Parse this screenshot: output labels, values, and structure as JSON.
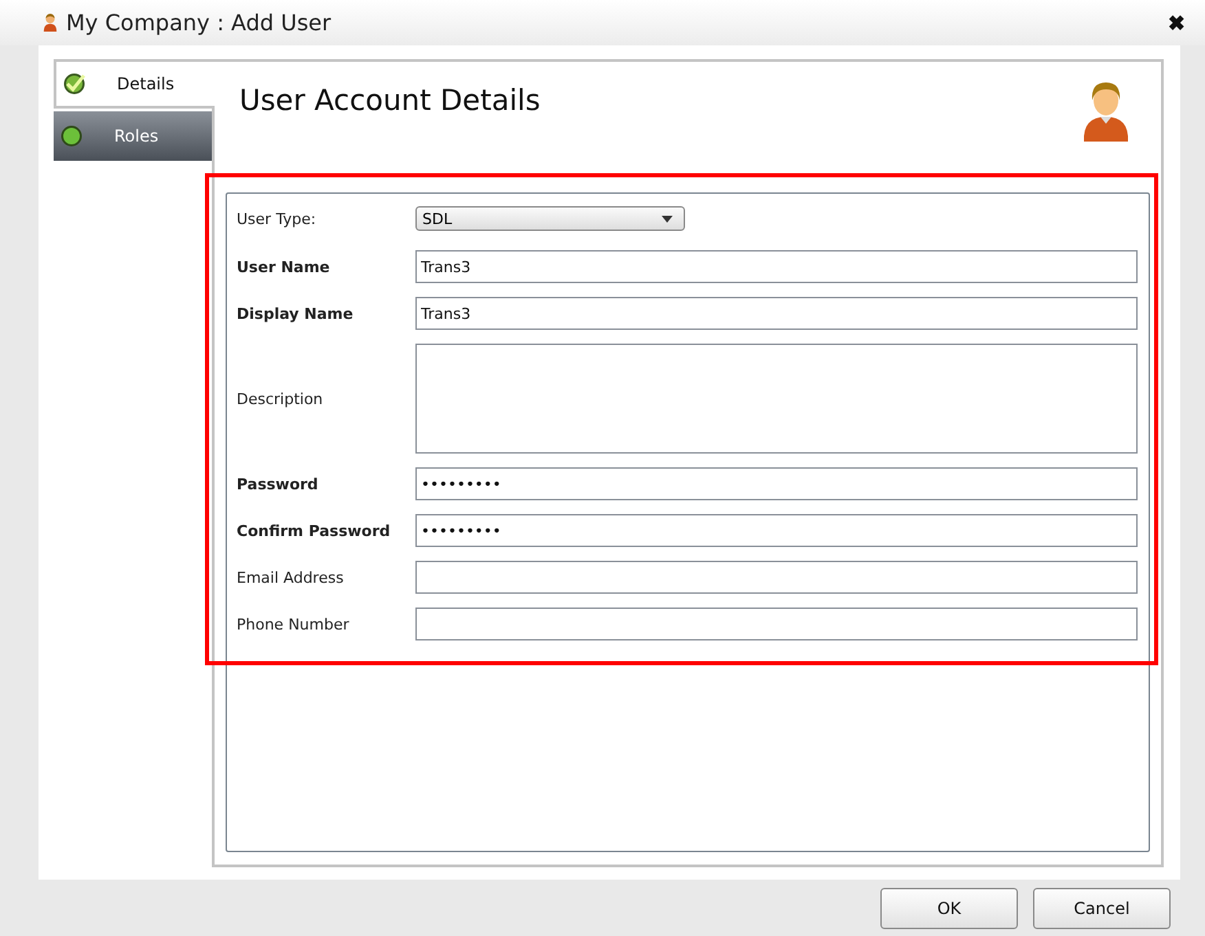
{
  "window": {
    "title": "My Company : Add User",
    "close": "✖"
  },
  "tabs": [
    {
      "label": "Details",
      "selected": true,
      "completed": true
    },
    {
      "label": "Roles",
      "selected": false,
      "completed": false
    }
  ],
  "heading": "User Account Details",
  "form": [
    {
      "kind": "dropdown",
      "label": "User Type:",
      "required": false,
      "value": "SDL"
    },
    {
      "kind": "text",
      "label": "User Name",
      "required": true,
      "value": "Trans3"
    },
    {
      "kind": "text",
      "label": "Display Name",
      "required": true,
      "value": "Trans3"
    },
    {
      "kind": "textarea",
      "label": "Description",
      "required": false
    },
    {
      "kind": "text",
      "label": "Password",
      "required": true,
      "value": "•••••••••"
    },
    {
      "kind": "text",
      "label": "Confirm Password",
      "required": true,
      "value": "•••••••••"
    },
    {
      "kind": "text",
      "label": "Email Address",
      "required": false
    },
    {
      "kind": "text",
      "label": "Phone Number",
      "required": false
    }
  ],
  "buttons": [
    "OK",
    "Cancel"
  ]
}
